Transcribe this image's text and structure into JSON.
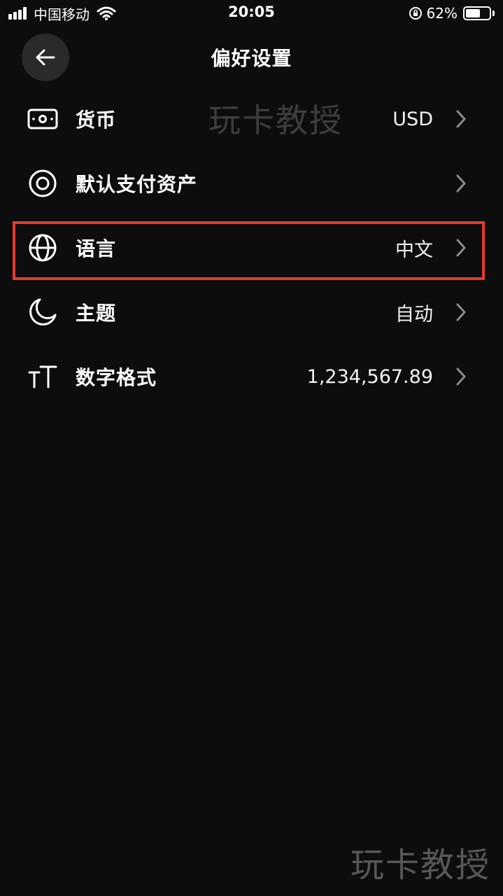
{
  "status_bar": {
    "carrier": "中国移动",
    "time": "20:05",
    "battery_percent": "62%",
    "battery_level": 0.62
  },
  "header": {
    "title": "偏好设置",
    "back_icon": "arrow-left-icon"
  },
  "settings": [
    {
      "icon": "banknote-icon",
      "label": "货币",
      "value": "USD"
    },
    {
      "icon": "target-circle-icon",
      "label": "默认支付资产",
      "value": ""
    },
    {
      "icon": "globe-icon",
      "label": "语言",
      "value": "中文"
    },
    {
      "icon": "moon-icon",
      "label": "主题",
      "value": "自动"
    },
    {
      "icon": "text-size-icon",
      "label": "数字格式",
      "value": "1,234,567.89"
    }
  ],
  "watermark": {
    "top_text": "玩卡教授",
    "bottom_text": "玩卡教授"
  },
  "colors": {
    "background": "#0d0d0d",
    "highlight": "#e53a2f",
    "back_button_bg": "#2a2a2a"
  }
}
